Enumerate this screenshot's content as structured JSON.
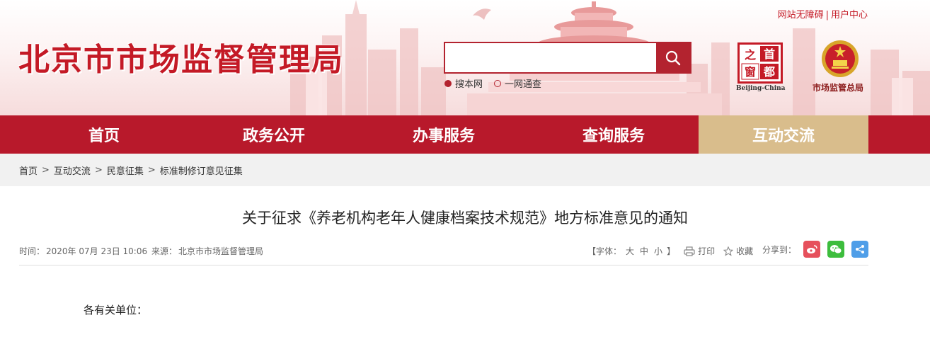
{
  "header": {
    "site_title": "北京市市场监督管理局",
    "top_links": [
      "网站无障碍",
      "用户中心"
    ],
    "search": {
      "placeholder": "",
      "button_icon": "search-icon"
    },
    "search_options": [
      {
        "label": "搜本网",
        "selected": true
      },
      {
        "label": "一网通查",
        "selected": false
      }
    ],
    "seal": {
      "chars": [
        "首",
        "都",
        "之",
        "窗"
      ],
      "caption": "Beijing-China"
    },
    "emblem_caption": "市场监管总局",
    "colors": {
      "brand_red": "#c41a26",
      "nav_red": "#b8192b",
      "active_gold": "#d9bd8c"
    }
  },
  "nav": {
    "items": [
      {
        "label": "首页",
        "active": false
      },
      {
        "label": "政务公开",
        "active": false
      },
      {
        "label": "办事服务",
        "active": false
      },
      {
        "label": "查询服务",
        "active": false
      },
      {
        "label": "互动交流",
        "active": true
      }
    ]
  },
  "breadcrumb": [
    "首页",
    "互动交流",
    "民意征集",
    "标准制修订意见征集"
  ],
  "article": {
    "title": "关于征求《养老机构老年人健康档案技术规范》地方标准意见的通知",
    "meta": {
      "time_label": "时间：",
      "time": "2020年 07月 23日 10:06",
      "source_label": "来源：",
      "source": "北京市市场监督管理局"
    },
    "font_size": {
      "prefix": "【字体：",
      "large": "大",
      "medium": "中",
      "small": "小",
      "suffix": "】"
    },
    "print_label": "打印",
    "favorite_label": "收藏",
    "share_label": "分享到：",
    "share_targets": [
      "weibo-icon",
      "wechat-icon",
      "share-icon"
    ],
    "salutation": "各有关单位："
  }
}
